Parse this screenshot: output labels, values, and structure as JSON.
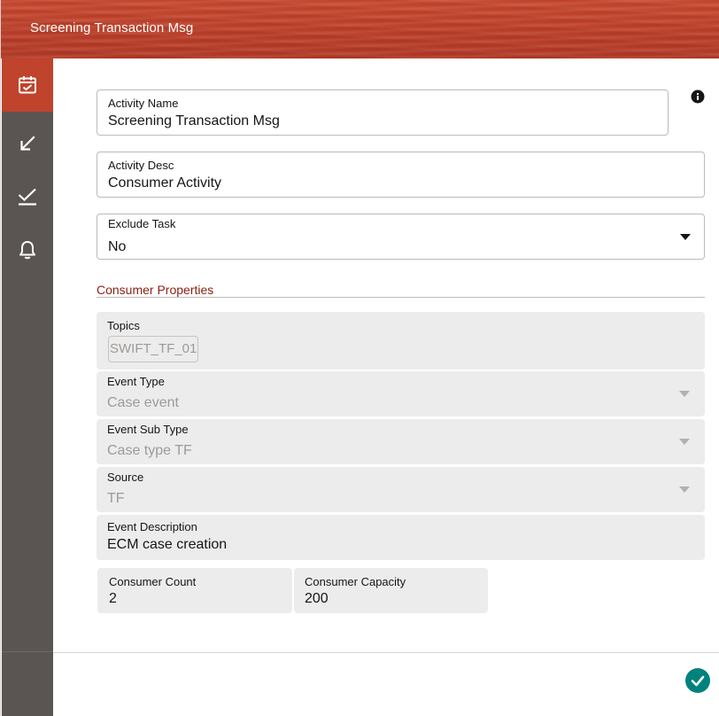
{
  "window": {
    "title": "Screening Transaction Msg"
  },
  "sidebar": {
    "items": [
      {
        "icon": "calendar-check-icon",
        "active": true
      },
      {
        "icon": "arrow-down-left-icon",
        "active": false
      },
      {
        "icon": "checkmark-underline-icon",
        "active": false
      },
      {
        "icon": "bell-icon",
        "active": false
      }
    ]
  },
  "form": {
    "activity_name": {
      "label": "Activity Name",
      "value": "Screening Transaction Msg"
    },
    "activity_desc": {
      "label": "Activity Desc",
      "value": "Consumer Activity"
    },
    "exclude_task": {
      "label": "Exclude Task",
      "value": "No"
    },
    "info_icon": "info-icon"
  },
  "consumer_properties": {
    "title": "Consumer Properties",
    "topics": {
      "label": "Topics",
      "chip": "SWIFT_TF_01"
    },
    "event_type": {
      "label": "Event Type",
      "value": "Case event"
    },
    "event_sub_type": {
      "label": "Event Sub Type",
      "value": "Case type TF"
    },
    "source": {
      "label": "Source",
      "value": "TF"
    },
    "event_description": {
      "label": "Event Description",
      "value": "ECM case creation"
    },
    "consumer_count": {
      "label": "Consumer Count",
      "value": "2"
    },
    "consumer_capacity": {
      "label": "Consumer Capacity",
      "value": "200"
    }
  },
  "footer": {
    "confirm_icon": "checkmark-icon"
  },
  "colors": {
    "header": "#c0432c",
    "sidebar": "#5a5452",
    "section_title": "#8a1f11",
    "confirm": "#00827c",
    "readonly_bg": "#ececec"
  }
}
